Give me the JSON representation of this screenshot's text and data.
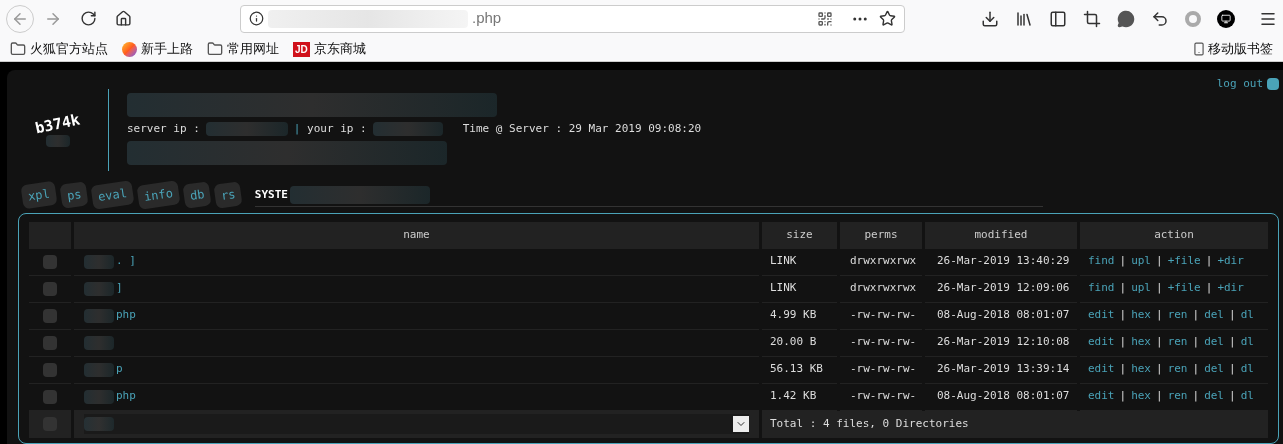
{
  "browser": {
    "url": ".php",
    "bookmarks": [
      {
        "kind": "folder",
        "label": "火狐官方站点"
      },
      {
        "kind": "firefox",
        "label": "新手上路"
      },
      {
        "kind": "folder",
        "label": "常用网址"
      },
      {
        "kind": "jd",
        "label": "京东商城",
        "badge": "JD"
      }
    ],
    "mobile_bookmarks": "移动版书签"
  },
  "header": {
    "logo": "b374k",
    "server_ip_label": "server ip :",
    "your_ip_label": "| your ip :",
    "time": "Time @ Server : 29 Mar 2019 09:08:20",
    "logout": "log out"
  },
  "tabs": [
    {
      "label": "xpl",
      "selected": false
    },
    {
      "label": "ps",
      "selected": false
    },
    {
      "label": "eval",
      "selected": false
    },
    {
      "label": "info",
      "selected": false
    },
    {
      "label": "db",
      "selected": false
    },
    {
      "label": "rs",
      "selected": false
    },
    {
      "label": "SYSTE",
      "selected": true
    }
  ],
  "table": {
    "columns": [
      "name",
      "size",
      "perms",
      "modified",
      "action"
    ],
    "separator": "|",
    "rows": [
      {
        "name": ". ]",
        "size": "LINK",
        "perms": "drwxrwxrwx",
        "modified": "26-Mar-2019 13:40:29",
        "actions": [
          "find",
          "upl",
          "+file",
          "+dir"
        ],
        "checked": false
      },
      {
        "name": "]",
        "size": "LINK",
        "perms": "drwxrwxrwx",
        "modified": "26-Mar-2019 12:09:06",
        "actions": [
          "find",
          "upl",
          "+file",
          "+dir"
        ],
        "checked": false
      },
      {
        "name": "php",
        "size": "4.99 KB",
        "perms": "-rw-rw-rw-",
        "modified": "08-Aug-2018 08:01:07",
        "actions": [
          "edit",
          "hex",
          "ren",
          "del",
          "dl"
        ],
        "checked": false
      },
      {
        "size": "20.00 B",
        "perms": "-rw-rw-rw-",
        "modified": "26-Mar-2019 12:10:08",
        "actions": [
          "edit",
          "hex",
          "ren",
          "del",
          "dl"
        ],
        "checked": false
      },
      {
        "name": "p",
        "size": "56.13 KB",
        "perms": "-rw-rw-rw-",
        "modified": "26-Mar-2019 13:39:14",
        "actions": [
          "edit",
          "hex",
          "ren",
          "del",
          "dl"
        ],
        "checked": false
      },
      {
        "name": "php",
        "size": "1.42 KB",
        "perms": "-rw-rw-rw-",
        "modified": "08-Aug-2018 08:01:07",
        "actions": [
          "edit",
          "hex",
          "ren",
          "del",
          "dl"
        ],
        "checked": false
      }
    ],
    "footer": {
      "checked": false,
      "total": "Total : 4 files, 0 Directories"
    }
  }
}
